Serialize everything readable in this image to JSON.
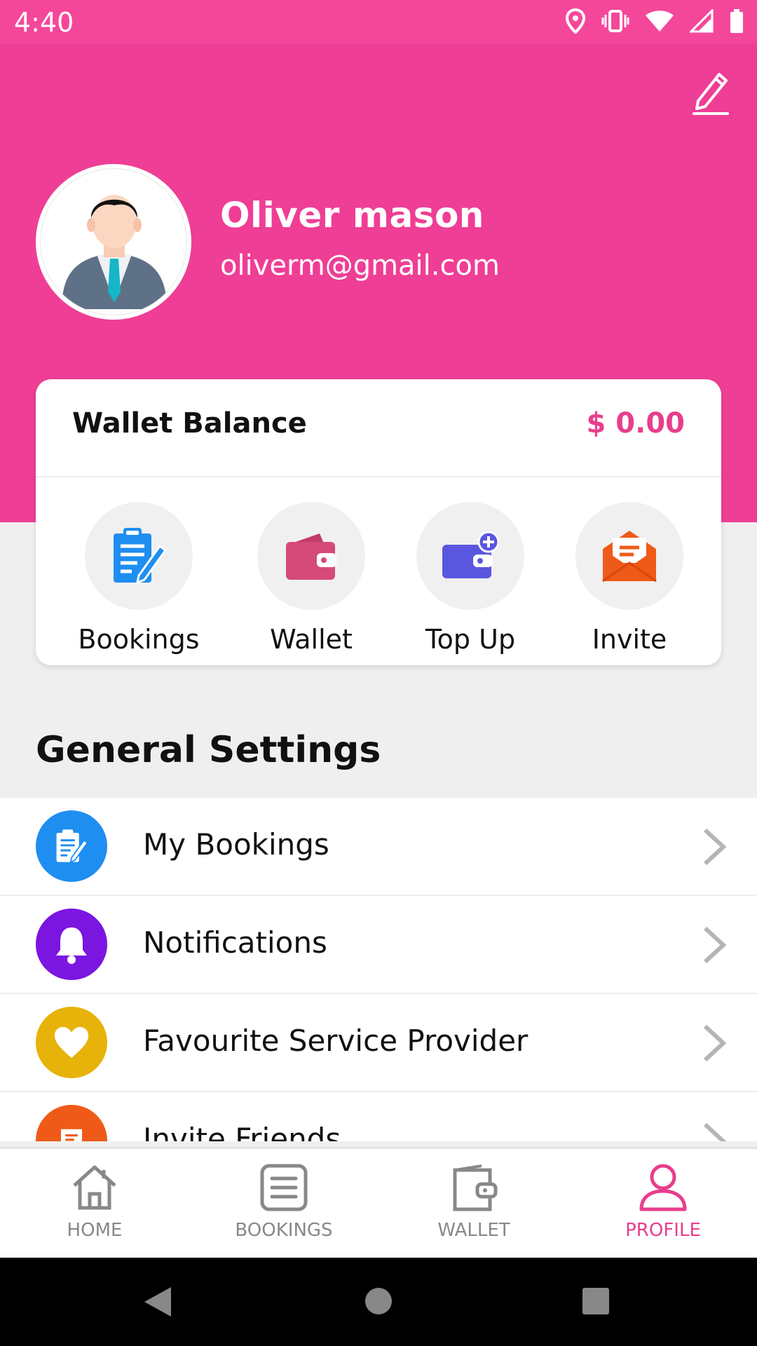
{
  "status_bar": {
    "time": "4:40"
  },
  "profile": {
    "name": "Oliver mason",
    "email": "oliverm@gmail.com"
  },
  "wallet": {
    "title": "Wallet Balance",
    "amount": "$ 0.00"
  },
  "quick_actions": [
    {
      "label": "Bookings",
      "icon": "clipboard-pen-icon",
      "color": "#1f8ef1"
    },
    {
      "label": "Wallet",
      "icon": "wallet-icon",
      "color": "#d64a7a"
    },
    {
      "label": "Top Up",
      "icon": "wallet-add-icon",
      "color": "#5a56e0"
    },
    {
      "label": "Invite",
      "icon": "envelope-icon",
      "color": "#ef5a18"
    }
  ],
  "general_settings": {
    "title": "General Settings",
    "items": [
      {
        "label": "My Bookings",
        "icon": "clipboard-pen-icon",
        "color": "#1f8ef1"
      },
      {
        "label": "Notifications",
        "icon": "bell-icon",
        "color": "#7a16e0"
      },
      {
        "label": "Favourite Service Provider",
        "icon": "heart-icon",
        "color": "#e7b30a"
      },
      {
        "label": "Invite Friends",
        "icon": "envelope-icon",
        "color": "#ef5a18"
      }
    ]
  },
  "bottom_nav": [
    {
      "label": "HOME",
      "icon": "home-icon",
      "active": false
    },
    {
      "label": "BOOKINGS",
      "icon": "list-icon",
      "active": false
    },
    {
      "label": "WALLET",
      "icon": "wallet-icon",
      "active": false
    },
    {
      "label": "PROFILE",
      "icon": "user-icon",
      "active": true
    }
  ],
  "colors": {
    "brand": "#ef3e95",
    "accent": "#e83e8c",
    "inactive": "#888888"
  }
}
